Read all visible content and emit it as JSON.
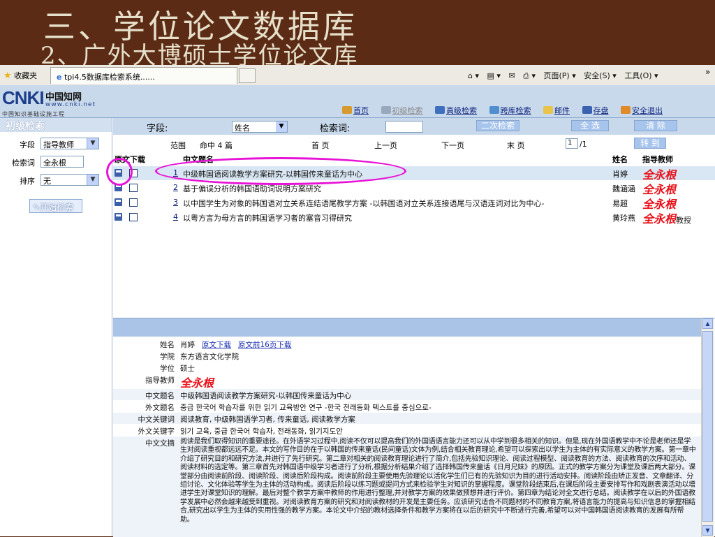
{
  "slide": {
    "title1": "三、学位论文数据库",
    "title2": "2、广外大博硕士学位论文库"
  },
  "browser": {
    "favorites": "收藏夹",
    "tab_title": "tpi4.5数据库检索系统......",
    "tools": [
      "页面(P) ▾",
      "安全(S) ▾",
      "工具(O) ▾"
    ],
    "overflow": "»"
  },
  "logo": {
    "mark": "CNKI",
    "cn": "中国知网",
    "www": "www.cnki.net",
    "sub": "中国知识基础设施工程"
  },
  "nav": {
    "home": "首页",
    "basic": "初级检索",
    "advanced": "高级检索",
    "cross": "跨库检索",
    "mail": "邮件",
    "save": "存盘",
    "logout": "安全退出"
  },
  "left": {
    "heading": "初级检索",
    "field_label": "字段",
    "field_value": "指导教师",
    "term_label": "检索词",
    "term_value": "全永根",
    "sort_label": "排序",
    "sort_value": "无",
    "search_btn": "开始检索"
  },
  "search": {
    "field_label": "字段:",
    "field_value": "姓名",
    "keyword_label": "检索词:",
    "secondary_btn": "二次检索",
    "select_all_btn": "全 选",
    "clear_btn": "清 除"
  },
  "paging": {
    "range": "范围",
    "hits": "命中 4 篇",
    "first": "首 页",
    "prev": "上一页",
    "next": "下一页",
    "last": "末 页",
    "page": "1",
    "total": "/1",
    "goto_btn": "转 到"
  },
  "table": {
    "col_download": "原文下载",
    "col_title": "中文题名",
    "col_name": "姓名",
    "col_advisor": "指导教师",
    "rows": [
      {
        "no": "1",
        "title": "中级韩国语阅读教学方案研究-以韩国传来童话为中心",
        "name": "肖婷",
        "advisor": "全永根",
        "suffix": ""
      },
      {
        "no": "2",
        "title": "基于偏误分析的韩国语助词说明方案研究",
        "name": "魏涵涵",
        "advisor": "全永根",
        "suffix": ""
      },
      {
        "no": "3",
        "title": "以中国学生为对象的韩国语对立关系连结语尾教学方案 -以韩国语对立关系连接语尾与汉语连词对比为中心-",
        "name": "易超",
        "advisor": "全永根",
        "suffix": ""
      },
      {
        "no": "4",
        "title": "以粤方言为母方言的韩国语学习者的塞音习得研究",
        "name": "黄玲燕",
        "advisor": "全永根",
        "suffix": "教授"
      }
    ]
  },
  "detail": {
    "name_label": "姓名",
    "name_value": "肖婷",
    "download": "原文下载",
    "download16": "原文前16页下载",
    "college_label": "学院",
    "college_value": "东方语言文化学院",
    "degree_label": "学位",
    "degree_value": "硕士",
    "advisor_label": "指导教师",
    "advisor_value": "全永根",
    "cn_title_label": "中文题名",
    "cn_title_value": "中级韩国语阅读教学方案研究-以韩国传来童话为中心",
    "fr_title_label": "外文题名",
    "fr_title_value": "중급 한국어 학습자를 위한 읽기 교육방안 연구 -한국 전래동화 텍스트를 중심으로-",
    "cn_kw_label": "中文关键词",
    "cn_kw_value": "阅读教育, 中级韩国语学习者, 传来童话, 阅读教学方案",
    "fr_kw_label": "外文关键字",
    "fr_kw_value": "읽기 교육, 중급 한국어 학습자, 전래동화, 읽기지도안",
    "abstract_label": "中文文摘",
    "abstract_value": "阅读是我们取得知识的重要途径。在外语学习过程中,阅读不仅可以提高我们的外国语语言能力还可以从中学到很多相关的知识。但是,现在外国语教学中不论是老师还是学生对阅读重视都远远不足。本文的写作目的在于以韩国的传来童话(民间童话)文体为例,结合相关教育理论,希望可以探索出以学生为主体的有实际意义的教学方案。第一章中介绍了研究目的和研究方法,并进行了先行研究。第二章对相关的阅读教育理论进行了简介,包括先验知识理论、阅读过程模型、阅读教育的方法、阅读教育的次序和活动、阅读材料的选定等。第三章首先对韩国语中级学习者进行了分析,根据分析结果介绍了选择韩国传来童话《日月兄妹》的原因。正式的教学方案分为课堂及课后两大部分。课堂部分由阅读前阶段、阅读阶段、阅读后阶段构成。阅读前阶段主要使用先验理论以活化学生们已有的先验知识为目的进行活动安排。阅读阶段由矫正发音、文章翻译、分组讨论、文化体验等学生为主体的活动构成。阅读后阶段以练习题或提问方式来检验学生对知识的掌握程度。课堂阶段结束后,在课后阶段主要安排写作和戏剧表演活动以增进学生对课堂知识的理解。最后对整个教学方案中教师的作用进行整理,并对教学方案的效果做预想并进行评价。第四章为结论对全文进行总结。阅读教学在以后的外国语教学发展中必然会越来越受到重视。对阅读教育方案的研究和对阅读教材的开发是主要任务。应该研究适合不同题材的不同教育方案,将语言能力的提高与知识信息的掌握相结合,研究出以学生为主体的实用性强的教学方案。本论文中介绍的教材选择条件和教学方案将在以后的研究中不断进行完善,希望可以对中国韩国语阅读教育的发展有所帮助。"
  },
  "colors": {
    "slide_bg": "#5b2b15",
    "slide_text": "#e6dfc9",
    "header_bg": "#c9d9ec",
    "advisor_red": "#e8101a",
    "highlight_magenta": "#e713d6",
    "link_blue": "#0a1f7a"
  }
}
